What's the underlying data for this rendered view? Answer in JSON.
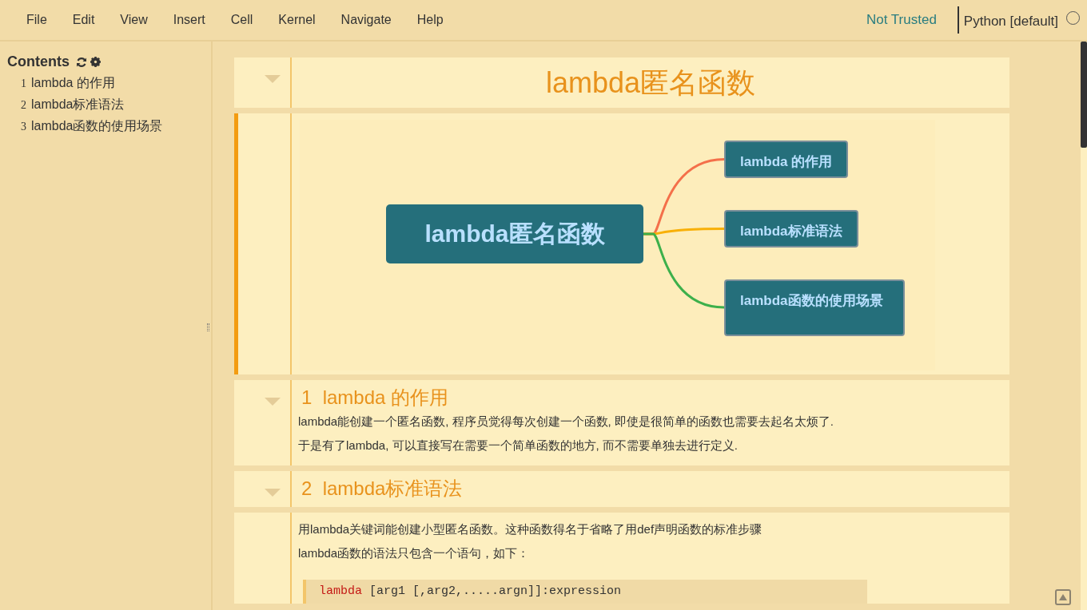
{
  "menu": [
    "File",
    "Edit",
    "View",
    "Insert",
    "Cell",
    "Kernel",
    "Navigate",
    "Help"
  ],
  "status": {
    "trust": "Not Trusted",
    "kernel": "Python [default]",
    "kernel_busy": false
  },
  "toc": {
    "title": "Contents",
    "items": [
      {
        "number": "1",
        "text": "lambda 的作用"
      },
      {
        "number": "2",
        "text": "lambda标准语法"
      },
      {
        "number": "3",
        "text": "lambda函数的使用场景"
      }
    ]
  },
  "cells": [
    {
      "kind": "title",
      "selected": false,
      "collapsible": true,
      "text": "lambda匿名函数"
    },
    {
      "kind": "mindmap",
      "selected": true,
      "collapsible": false,
      "root": "lambda匿名函数",
      "branches": [
        {
          "text": "lambda 的作用",
          "color": "#f4704a"
        },
        {
          "text": "lambda标准语法",
          "color": "#f8b008"
        },
        {
          "text": "lambda函数的使用场景",
          "color": "#3db04b"
        }
      ]
    },
    {
      "kind": "section",
      "selected": false,
      "collapsible": true,
      "number": "1",
      "title": "lambda 的作用",
      "paragraphs": [
        "lambda能创建一个匿名函数, 程序员觉得每次创建一个函数, 即使是很简单的函数也需要去起名太烦了.",
        "于是有了lambda, 可以直接写在需要一个简单函数的地方, 而不需要单独去进行定义."
      ]
    },
    {
      "kind": "section",
      "selected": false,
      "collapsible": true,
      "number": "2",
      "title": "lambda标准语法"
    },
    {
      "kind": "markdown",
      "selected": false,
      "collapsible": false,
      "paragraphs": [
        "用lambda关键词能创建小型匿名函数。这种函数得名于省略了用def声明函数的标准步骤",
        "lambda函数的语法只包含一个语句，如下："
      ],
      "code": [
        {
          "kind": "keyword",
          "text": "lambda"
        },
        {
          "kind": "plain",
          "text": "[arg1 [,arg2,.....argn]]:expression"
        }
      ]
    }
  ]
}
